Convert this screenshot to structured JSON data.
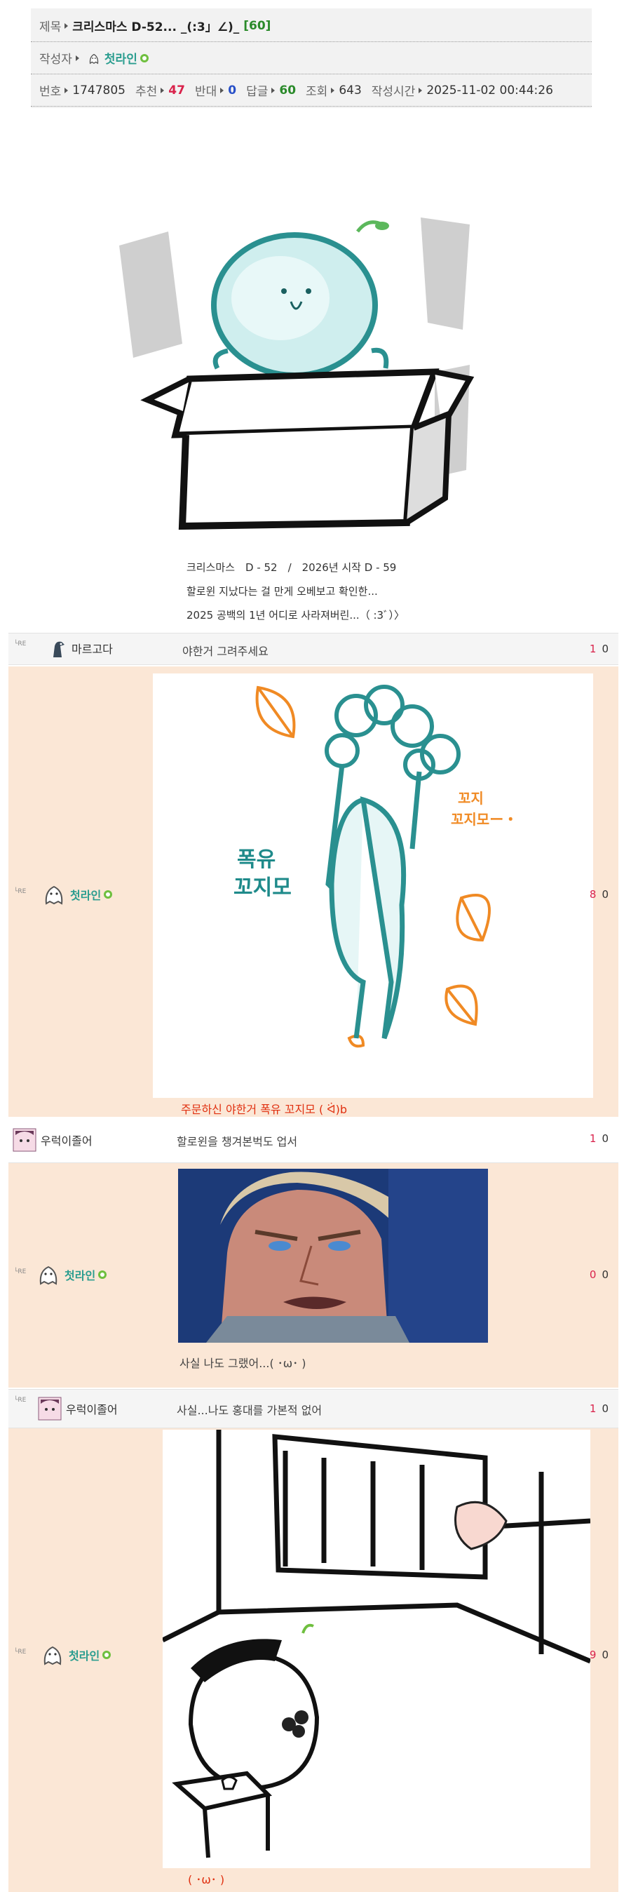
{
  "header": {
    "title_label": "제목",
    "title": "크리스마스 D-52... _(:3」∠)_",
    "comment_count": "[60]",
    "author_label": "작성자",
    "author": "첫라인",
    "no_label": "번호",
    "no": "1747805",
    "up_label": "추천",
    "up": "47",
    "down_label": "반대",
    "down": "0",
    "reply_label": "답글",
    "reply": "60",
    "view_label": "조회",
    "view": "643",
    "time_label": "작성시간",
    "time": "2025-11-02 00:44:26"
  },
  "post": {
    "image_icon": "mochi-character-in-box-illustration",
    "lines": [
      "크리스마스　D - 52　/　2026년 시작 D - 59",
      "할로윈 지났다는 걸 만게 오베보고 확인한...",
      "2025 공백의 1년 어디로 사라져버린...（ :3ﾞ）〉"
    ]
  },
  "comments": [
    {
      "re": "└RE",
      "user": "마르고다",
      "text": "야한거 그려주세요",
      "up": "1",
      "down": "0"
    },
    {
      "re": "└RE",
      "user": "첫라인",
      "image_icon": "dancing-character-with-leaves-drawing",
      "image_text": [
        "폭유",
        "꼬지모",
        "꼬지",
        "꼬지모ー・"
      ],
      "caption": "주문하신 야한거 폭유 꼬지모 ( ᐛ)b",
      "up": "8",
      "down": "0"
    },
    {
      "user": "우럭이졸어",
      "text": "할로윈을 챙겨본벅도 업서",
      "up": "1",
      "down": "0"
    },
    {
      "re": "└RE",
      "user": "첫라인",
      "image_icon": "anime-man-reaction-image",
      "caption": "사실 나도 그랬어...( ･ω･ )",
      "up": "0",
      "down": "0"
    },
    {
      "re": "└RE",
      "user": "우럭이졸어",
      "text": "사실...나도 홍대를 가본적 없어",
      "up": "1",
      "down": "0"
    },
    {
      "re": "└RE",
      "user": "첫라인",
      "image_icon": "character-looking-out-window-drawing",
      "caption": "( ･ω･ )",
      "up": "9",
      "down": "0"
    }
  ],
  "colors": {
    "accent_red": "#d9224b",
    "accent_blue": "#2850c8",
    "accent_green": "#2a8a2a",
    "author_teal": "#2a9d8f",
    "peach_bg": "#fbe7d6"
  }
}
